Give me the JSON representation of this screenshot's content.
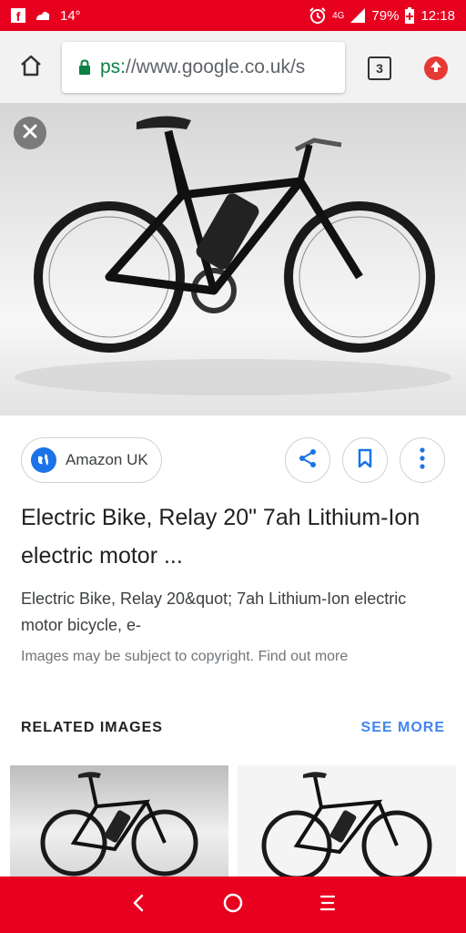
{
  "status_bar": {
    "temperature": "14°",
    "network": "4G",
    "battery": "79%",
    "time": "12:18",
    "icons": [
      "facebook-icon",
      "weather-icon",
      "alarm-icon",
      "signal-icon",
      "battery-icon"
    ]
  },
  "browser": {
    "url_scheme": "ps:",
    "url_rest": "//www.google.co.uk/s",
    "tab_count": "3",
    "icons": [
      "home-icon",
      "lock-icon",
      "upload-icon"
    ]
  },
  "image_viewer": {
    "source_name": "Amazon UK",
    "title": "Electric Bike, Relay 20\" 7ah Lithium-Ion electric motor ...",
    "description": "Electric Bike, Relay 20&quot; 7ah Lithium-Ion electric motor bicycle, e-",
    "copyright": "Images may be subject to copyright. Find out more",
    "icons": [
      "close-icon",
      "globe-icon",
      "share-icon",
      "bookmark-icon",
      "more-vert-icon"
    ]
  },
  "related": {
    "heading": "RELATED IMAGES",
    "see_more": "SEE MORE"
  },
  "colors": {
    "status_red": "#e8001f",
    "link_blue": "#4285f4",
    "secure_green": "#0b8043"
  }
}
